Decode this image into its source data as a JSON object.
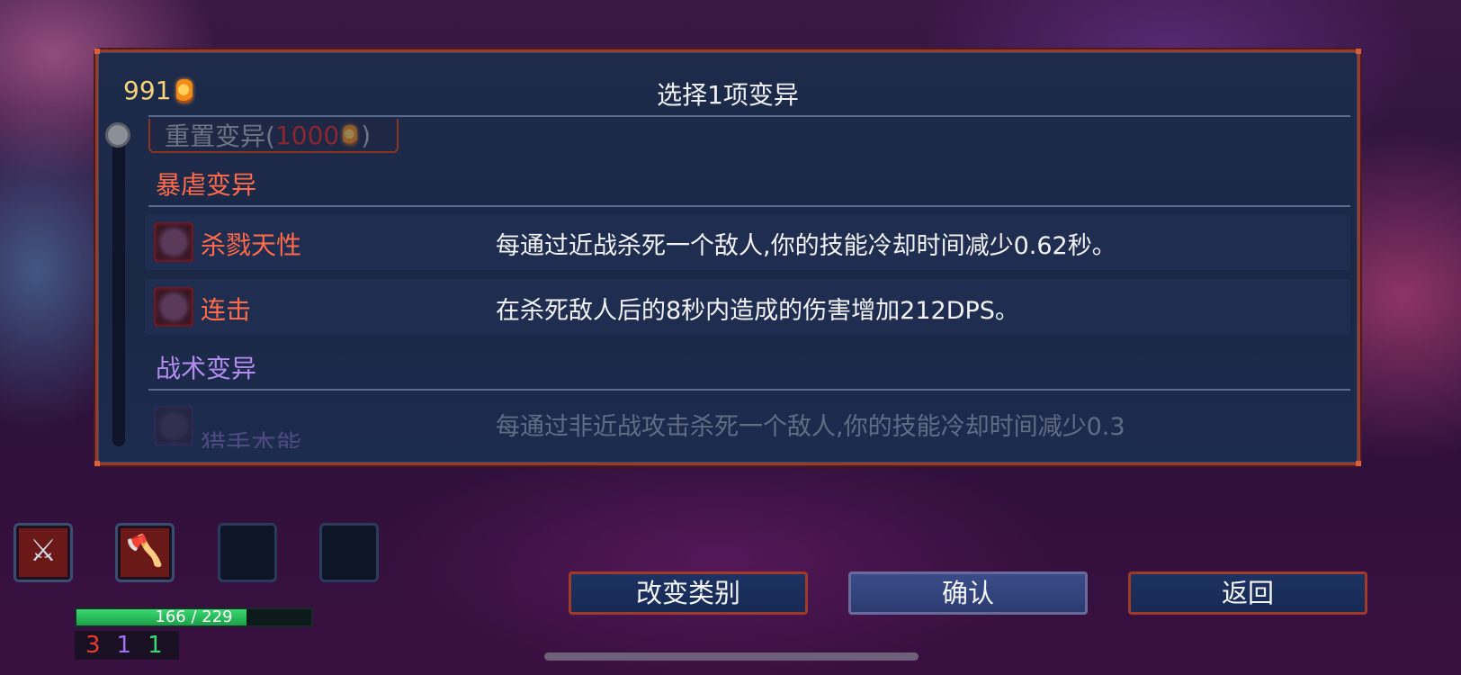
{
  "header": {
    "gold": "991",
    "title": "选择1项变异",
    "reset_label": "重置变异(",
    "reset_cost": "1000",
    "reset_close": ")"
  },
  "categories": {
    "brutality": {
      "label": "暴虐变异",
      "color": "#ff6a48"
    },
    "tactics": {
      "label": "战术变异",
      "color": "#b48cf0"
    }
  },
  "mutations": [
    {
      "name": "杀戮天性",
      "desc": "每通过近战杀死一个敌人,你的技能冷却时间减少0.62秒。",
      "icon": "blade-icon"
    },
    {
      "name": "连击",
      "desc": "在杀死敌人后的8秒内造成的伤害增加212DPS。",
      "icon": "pickaxe-icon"
    },
    {
      "name": "猎手本能",
      "desc": "每通过非近战攻击杀死一个敌人,你的技能冷却时间减少0.3",
      "icon": "bow-icon"
    }
  ],
  "buttons": {
    "change_category": "改变类别",
    "confirm": "确认",
    "back": "返回"
  },
  "player": {
    "hp_current": 166,
    "hp_max": 229,
    "hp_text": "166 / 229",
    "stats": {
      "brutality": "3",
      "tactics": "1",
      "survival": "1"
    },
    "stat_colors": {
      "brutality": "#e83a2a",
      "tactics": "#a070f0",
      "survival": "#3ad870"
    }
  },
  "equipment_slots": [
    {
      "item": "whip-sword-icon",
      "glyph": "⚔"
    },
    {
      "item": "fire-axe-icon",
      "glyph": "🪓"
    },
    {
      "item": "empty-slot"
    },
    {
      "item": "empty-slot"
    }
  ]
}
